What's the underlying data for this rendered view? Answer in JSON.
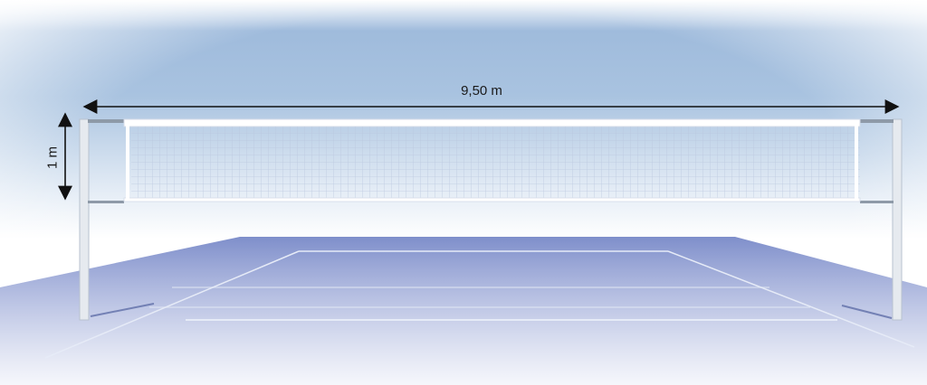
{
  "dimensions": {
    "net_width": "9,50 m",
    "net_height": "1 m"
  },
  "colors": {
    "sky_top": "#7fa6cf",
    "sky_bottom": "#ffffff",
    "court": "#8f9fd0",
    "court_dark": "#7d8cc3",
    "court_lines": "#e8edf8",
    "net_mesh": "#c9d3e6",
    "post": "#e6eaef",
    "arrow": "#111111"
  }
}
